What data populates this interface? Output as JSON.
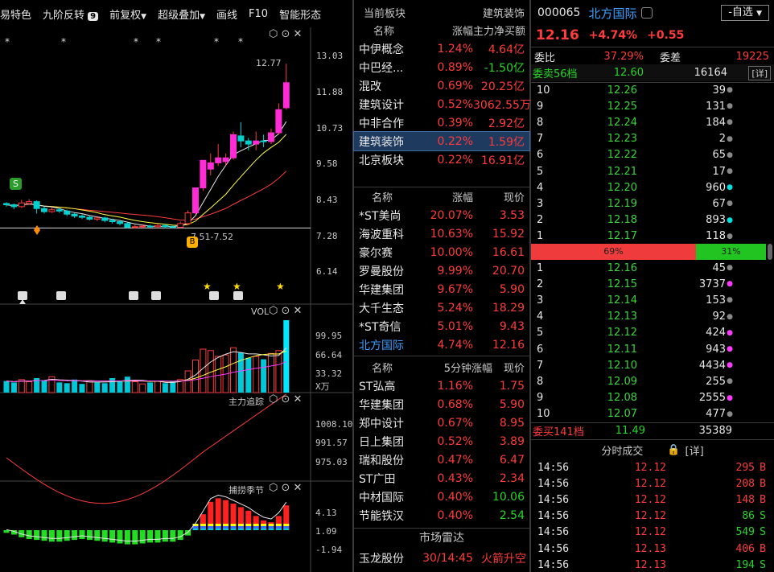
{
  "toolbar": {
    "items": [
      "易特色",
      "九阶反转",
      "前复权",
      "超级叠加",
      "画线",
      "F10",
      "智能形态"
    ],
    "badge": "9"
  },
  "chart": {
    "price_axis": [
      "13.03",
      "11.88",
      "10.73",
      "9.58",
      "8.43",
      "7.28",
      "6.14"
    ],
    "price_high_label": "12.77",
    "price_low_label": "7.51-7.52",
    "vol_title": "VOL",
    "vol_axis": [
      "99.95",
      "66.64",
      "33.32",
      "X万"
    ],
    "zl_title": "主力追踪",
    "zl_axis": [
      "1008.10",
      "991.57",
      "975.03"
    ],
    "bl_title": "捕捞季节",
    "bl_axis": [
      "4.13",
      "1.09",
      "-1.94"
    ],
    "marker_s": "S",
    "marker_b": "B",
    "candles": [
      {
        "o": 8.3,
        "c": 8.26,
        "h": 8.34,
        "l": 8.2
      },
      {
        "o": 8.26,
        "c": 8.2,
        "h": 8.3,
        "l": 8.12
      },
      {
        "o": 8.2,
        "c": 8.32,
        "h": 8.42,
        "l": 8.16
      },
      {
        "o": 8.3,
        "c": 8.36,
        "h": 8.44,
        "l": 8.26
      },
      {
        "o": 8.36,
        "c": 8.14,
        "h": 8.4,
        "l": 7.98
      },
      {
        "o": 8.14,
        "c": 8.04,
        "h": 8.2,
        "l": 7.98
      },
      {
        "o": 8.04,
        "c": 8.1,
        "h": 8.18,
        "l": 8.0
      },
      {
        "o": 8.1,
        "c": 8.06,
        "h": 8.16,
        "l": 8.0
      },
      {
        "o": 8.06,
        "c": 7.96,
        "h": 8.1,
        "l": 7.9
      },
      {
        "o": 7.96,
        "c": 7.9,
        "h": 8.0,
        "l": 7.84
      },
      {
        "o": 7.9,
        "c": 7.86,
        "h": 7.96,
        "l": 7.8
      },
      {
        "o": 7.86,
        "c": 7.8,
        "h": 7.92,
        "l": 7.76
      },
      {
        "o": 7.8,
        "c": 7.84,
        "h": 7.9,
        "l": 7.74
      },
      {
        "o": 7.84,
        "c": 7.76,
        "h": 7.88,
        "l": 7.7
      },
      {
        "o": 7.76,
        "c": 7.72,
        "h": 7.82,
        "l": 7.66
      },
      {
        "o": 7.72,
        "c": 7.66,
        "h": 7.78,
        "l": 7.6
      },
      {
        "o": 7.66,
        "c": 7.54,
        "h": 7.7,
        "l": 7.5
      },
      {
        "o": 7.54,
        "c": 7.56,
        "h": 7.62,
        "l": 7.5
      },
      {
        "o": 7.56,
        "c": 7.58,
        "h": 7.64,
        "l": 7.52
      },
      {
        "o": 7.58,
        "c": 7.56,
        "h": 7.62,
        "l": 7.52
      },
      {
        "o": 7.56,
        "c": 7.6,
        "h": 7.66,
        "l": 7.52
      },
      {
        "o": 7.6,
        "c": 7.56,
        "h": 7.64,
        "l": 7.51
      },
      {
        "o": 7.56,
        "c": 7.54,
        "h": 7.6,
        "l": 7.51
      },
      {
        "o": 7.54,
        "c": 7.66,
        "h": 7.72,
        "l": 7.52
      },
      {
        "o": 7.66,
        "c": 8.0,
        "h": 8.08,
        "l": 7.62
      },
      {
        "o": 8.0,
        "c": 8.8,
        "h": 8.8,
        "l": 7.96
      },
      {
        "o": 8.8,
        "c": 9.68,
        "h": 9.68,
        "l": 8.7
      },
      {
        "o": 9.4,
        "c": 9.6,
        "h": 9.9,
        "l": 9.2
      },
      {
        "o": 9.6,
        "c": 9.76,
        "h": 10.2,
        "l": 9.5
      },
      {
        "o": 9.64,
        "c": 9.76,
        "h": 9.9,
        "l": 9.52
      },
      {
        "o": 9.76,
        "c": 10.5,
        "h": 10.6,
        "l": 9.7
      },
      {
        "o": 10.46,
        "c": 10.3,
        "h": 10.9,
        "l": 10.1
      },
      {
        "o": 10.3,
        "c": 10.2,
        "h": 10.4,
        "l": 10.0
      },
      {
        "o": 10.2,
        "c": 10.3,
        "h": 10.6,
        "l": 10.0
      },
      {
        "o": 10.3,
        "c": 10.28,
        "h": 10.5,
        "l": 10.1
      },
      {
        "o": 10.28,
        "c": 10.56,
        "h": 10.7,
        "l": 10.2
      },
      {
        "o": 10.56,
        "c": 11.3,
        "h": 11.5,
        "l": 10.5
      },
      {
        "o": 11.36,
        "c": 12.16,
        "h": 12.77,
        "l": 11.3
      }
    ],
    "volumes": [
      16,
      14,
      18,
      15,
      20,
      17,
      22,
      14,
      13,
      18,
      12,
      16,
      14,
      13,
      20,
      16,
      22,
      15,
      12,
      14,
      16,
      13,
      15,
      18,
      30,
      45,
      60,
      58,
      50,
      52,
      62,
      55,
      48,
      50,
      46,
      54,
      58,
      99.95
    ],
    "vol_colors": [
      "c",
      "c",
      "r",
      "r",
      "c",
      "c",
      "r",
      "c",
      "c",
      "c",
      "c",
      "r",
      "c",
      "c",
      "c",
      "c",
      "c",
      "r",
      "r",
      "c",
      "r",
      "c",
      "c",
      "r",
      "r",
      "r",
      "r",
      "r",
      "r",
      "r",
      "r",
      "c",
      "c",
      "r",
      "c",
      "r",
      "r",
      "c"
    ]
  },
  "sector": {
    "h1": "当前板块",
    "h2": "建筑装饰",
    "cols": [
      "名称",
      "涨幅",
      "主力净买额"
    ],
    "rows": [
      [
        "中伊概念",
        "1.24%",
        "4.64亿"
      ],
      [
        "中巴经...",
        "0.89%",
        "-1.50亿"
      ],
      [
        "混改",
        "0.69%",
        "20.25亿"
      ],
      [
        "建筑设计",
        "0.52%",
        "3062.55万"
      ],
      [
        "中非合作",
        "0.39%",
        "2.92亿"
      ],
      [
        "建筑装饰",
        "0.22%",
        "1.59亿"
      ],
      [
        "北京板块",
        "0.22%",
        "16.91亿"
      ]
    ]
  },
  "gainers": {
    "cols": [
      "名称",
      "涨幅",
      "现价"
    ],
    "rows": [
      [
        "*ST美尚",
        "20.07%",
        "3.53"
      ],
      [
        "海波重科",
        "10.63%",
        "15.92"
      ],
      [
        "豪尔赛",
        "10.00%",
        "16.61"
      ],
      [
        "罗曼股份",
        "9.99%",
        "20.70"
      ],
      [
        "华建集团",
        "9.67%",
        "5.90"
      ],
      [
        "大千生态",
        "5.24%",
        "18.29"
      ],
      [
        "*ST奇信",
        "5.01%",
        "9.43"
      ],
      [
        "北方国际",
        "4.74%",
        "12.16"
      ]
    ]
  },
  "speed": {
    "cols": [
      "名称",
      "5分钟涨幅",
      "现价"
    ],
    "rows": [
      [
        "ST弘高",
        "1.16%",
        "1.75"
      ],
      [
        "华建集团",
        "0.68%",
        "5.90"
      ],
      [
        "郑中设计",
        "0.67%",
        "8.95"
      ],
      [
        "日上集团",
        "0.52%",
        "3.89"
      ],
      [
        "瑞和股份",
        "0.47%",
        "6.47"
      ],
      [
        "ST广田",
        "0.43%",
        "2.34"
      ],
      [
        "中材国际",
        "0.40%",
        "10.06"
      ],
      [
        "节能铁汉",
        "0.40%",
        "2.54"
      ]
    ]
  },
  "radar": {
    "title": "市场雷达",
    "row": [
      "玉龙股份",
      "30/14:45",
      "火箭升空"
    ]
  },
  "stock": {
    "code": "000065",
    "name": "北方国际",
    "select": "-自选",
    "price": "12.16",
    "pct": "+4.74%",
    "chg": "+0.55",
    "wb_label": "委比",
    "wb": "37.29%",
    "wc_label": "委差",
    "wc": "19225",
    "sell_label": "委卖56档",
    "sell_price": "12.60",
    "sell_vol": "16164",
    "detail": "[详]",
    "asks": [
      [
        "10",
        "12.26",
        "39",
        "g"
      ],
      [
        "9",
        "12.25",
        "131",
        "g"
      ],
      [
        "8",
        "12.24",
        "184",
        "g"
      ],
      [
        "7",
        "12.23",
        "2",
        "g"
      ],
      [
        "6",
        "12.22",
        "65",
        "g"
      ],
      [
        "5",
        "12.21",
        "17",
        "g"
      ],
      [
        "4",
        "12.20",
        "960",
        "c"
      ],
      [
        "3",
        "12.19",
        "67",
        "g"
      ],
      [
        "2",
        "12.18",
        "893",
        "c"
      ],
      [
        "1",
        "12.17",
        "118",
        "g"
      ]
    ],
    "ratio_buy": "69%",
    "ratio_sell": "31%",
    "bids": [
      [
        "1",
        "12.16",
        "45",
        "g"
      ],
      [
        "2",
        "12.15",
        "3737",
        "m"
      ],
      [
        "3",
        "12.14",
        "153",
        "g"
      ],
      [
        "4",
        "12.13",
        "92",
        "g"
      ],
      [
        "5",
        "12.12",
        "424",
        "m"
      ],
      [
        "6",
        "12.11",
        "943",
        "m"
      ],
      [
        "7",
        "12.10",
        "4434",
        "m"
      ],
      [
        "8",
        "12.09",
        "255",
        "g"
      ],
      [
        "9",
        "12.08",
        "2555",
        "m"
      ],
      [
        "10",
        "12.07",
        "477",
        "g"
      ]
    ],
    "buy_label": "委买141档",
    "buy_price": "11.49",
    "buy_vol": "35389",
    "ticks_title": "分时成交",
    "ticks_detail": "[详]",
    "ticks": [
      [
        "14:56",
        "12.12",
        "295",
        "B"
      ],
      [
        "14:56",
        "12.12",
        "208",
        "B"
      ],
      [
        "14:56",
        "12.12",
        "148",
        "B"
      ],
      [
        "14:56",
        "12.12",
        "86",
        "S"
      ],
      [
        "14:56",
        "12.12",
        "549",
        "S"
      ],
      [
        "14:56",
        "12.13",
        "406",
        "B"
      ],
      [
        "14:56",
        "12.13",
        "194",
        "S"
      ]
    ]
  }
}
